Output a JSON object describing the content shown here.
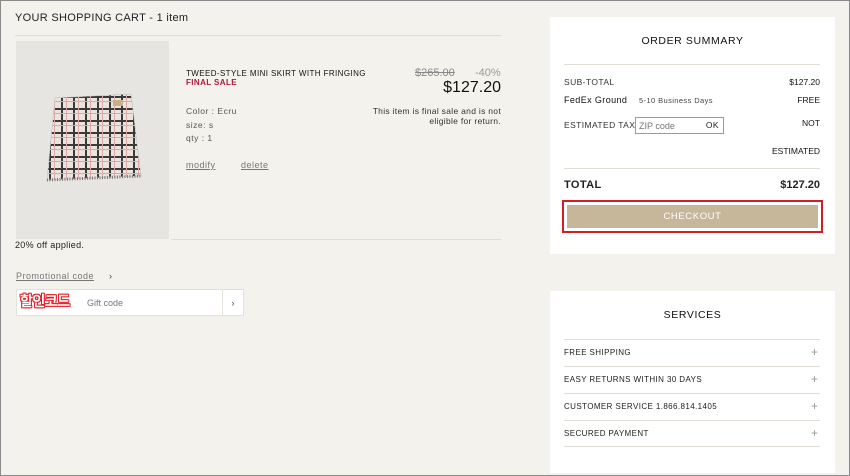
{
  "cart": {
    "title": "YOUR SHOPPING CART - 1 item"
  },
  "product": {
    "name": "TWEED-STYLE MINI SKIRT WITH FRINGING",
    "final_sale": "FINAL SALE",
    "color": "Color : Ecru",
    "size": "size: s",
    "qty": "qty : 1",
    "modify": "modify",
    "delete": "delete",
    "old_price": "$265.00",
    "discount": "-40%",
    "price": "$127.20",
    "note": "This item is final sale and is not eligible for return."
  },
  "discount_applied": "20% off applied.",
  "promo": {
    "link": "Promotional code",
    "chevron": "›",
    "input_placeholder": "Gift code",
    "submit": "›",
    "overlay_label": "할인코드"
  },
  "summary": {
    "title": "ORDER SUMMARY",
    "subtotal_label": "SUB-TOTAL",
    "subtotal_value": "$127.20",
    "shipping_label": "FedEx Ground",
    "shipping_days": "5-10 Business Days",
    "shipping_value": "FREE",
    "tax_label": "ESTIMATED TAX",
    "zip_placeholder": "ZIP code",
    "zip_ok": "OK",
    "tax_value_1": "NOT",
    "tax_value_2": "ESTIMATED",
    "total_label": "TOTAL",
    "total_value": "$127.20",
    "checkout": "CHECKOUT"
  },
  "services": {
    "title": "SERVICES",
    "items": [
      {
        "label": "FREE SHIPPING",
        "icon": "+"
      },
      {
        "label": "EASY RETURNS WITHIN 30 DAYS",
        "icon": "+"
      },
      {
        "label": "CUSTOMER SERVICE 1.866.814.1405",
        "icon": "+"
      },
      {
        "label": "SECURED PAYMENT",
        "icon": "+"
      }
    ]
  },
  "colors": {
    "background": "#f4f2ed",
    "final_sale": "#b0173a",
    "checkout_button": "#c6b69a",
    "highlight_frame": "#d31d23"
  }
}
